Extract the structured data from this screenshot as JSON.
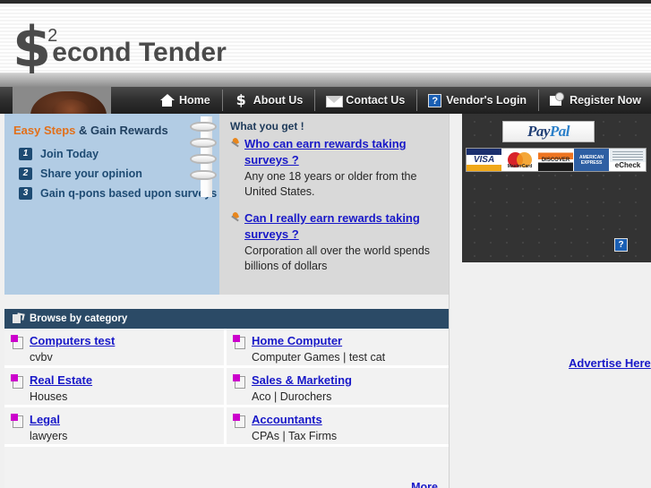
{
  "site": {
    "logo_symbol": "$",
    "logo_superscript": "2",
    "logo_word": "econd Tender"
  },
  "nav": {
    "items": [
      {
        "label": "Home",
        "icon": "house-icon"
      },
      {
        "label": "About Us",
        "icon": "dollar-icon"
      },
      {
        "label": "Contact Us",
        "icon": "envelope-icon"
      },
      {
        "label": "Vendor's Login",
        "icon": "question-mark-icon",
        "glyph": "?"
      },
      {
        "label": "Register Now",
        "icon": "register-card-icon"
      }
    ]
  },
  "hero": {
    "title_orange": "Easy Steps",
    "title_navy": " & Gain Rewards",
    "steps": [
      {
        "num": "1",
        "label": "Join Today"
      },
      {
        "num": "2",
        "label": "Share your opinion"
      },
      {
        "num": "3",
        "label": "Gain q-pons based upon surveys"
      }
    ],
    "what_you_get": "What you get !",
    "faqs": [
      {
        "question": "Who can earn rewards taking surveys ?",
        "answer": "Any one 18 years or older from the United States."
      },
      {
        "question": "Can I really earn rewards taking surveys ?",
        "answer": "Corporation all over the world spends billions of dollars"
      }
    ]
  },
  "categories": {
    "header": "Browse by category",
    "header_icon": "folder-browse-icon",
    "more_label": "More",
    "rows": [
      [
        {
          "name": "Computers test",
          "sub": "cvbv"
        },
        {
          "name": "Home Computer",
          "sub": "Computer Games | test cat"
        }
      ],
      [
        {
          "name": "Real Estate",
          "sub": "Houses"
        },
        {
          "name": "Sales & Marketing",
          "sub": "Aco | Durochers"
        }
      ],
      [
        {
          "name": "Legal",
          "sub": "lawyers"
        },
        {
          "name": "Accountants",
          "sub": "CPAs | Tax Firms"
        }
      ]
    ]
  },
  "sidebar": {
    "paypal_part1": "Pay",
    "paypal_part2": "Pal",
    "cards": [
      {
        "label": "VISA",
        "name": "visa-card-logo"
      },
      {
        "label": "MasterCard",
        "name": "mastercard-logo"
      },
      {
        "label": "DISCOVER",
        "name": "discover-card-logo"
      },
      {
        "label": "AMERICAN EXPRESS",
        "name": "amex-card-logo"
      },
      {
        "label": "eCheck",
        "name": "echeck-logo"
      }
    ],
    "broken_image_glyph": "?",
    "advertise_label": "Advertise Here"
  },
  "colors": {
    "navy": "#2b4a66",
    "light_blue_panel": "#b2cce4",
    "orange": "#e2701a",
    "link_blue": "#1818c8",
    "dark_panel": "#333333"
  }
}
